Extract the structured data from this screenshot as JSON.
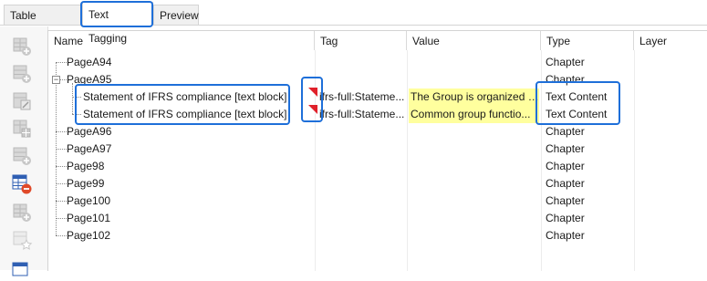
{
  "tabs": [
    {
      "label": "Table Tagging"
    },
    {
      "label": "Text Tagging"
    },
    {
      "label": "Preview"
    }
  ],
  "active_tab": "Text Tagging",
  "columns": {
    "name": "Name",
    "tag": "Tag",
    "value": "Value",
    "type": "Type",
    "layer": "Layer"
  },
  "rows": [
    {
      "name": "PageA94",
      "tag": "",
      "value": "",
      "type": "Chapter"
    },
    {
      "name": "PageA95",
      "tag": "",
      "value": "",
      "type": "Chapter"
    },
    {
      "name": "Statement of IFRS compliance [text block]",
      "tag": "ifrs-full:Stateme...",
      "value": "The Group is organized i...",
      "type": "Text Content"
    },
    {
      "name": "Statement of IFRS compliance [text block]",
      "tag": "ifrs-full:Stateme...",
      "value": "Common group functio...",
      "type": "Text Content"
    },
    {
      "name": "PageA96",
      "tag": "",
      "value": "",
      "type": "Chapter"
    },
    {
      "name": "PageA97",
      "tag": "",
      "value": "",
      "type": "Chapter"
    },
    {
      "name": "Page98",
      "tag": "",
      "value": "",
      "type": "Chapter"
    },
    {
      "name": "Page99",
      "tag": "",
      "value": "",
      "type": "Chapter"
    },
    {
      "name": "Page100",
      "tag": "",
      "value": "",
      "type": "Chapter"
    },
    {
      "name": "Page101",
      "tag": "",
      "value": "",
      "type": "Chapter"
    },
    {
      "name": "Page102",
      "tag": "",
      "value": "",
      "type": "Chapter"
    }
  ],
  "colors": {
    "highlight_border": "#1e6fd9",
    "value_highlight": "#ffff9e",
    "tag_marker": "#e0202a"
  },
  "toolbar_icons": [
    "add-table-icon",
    "add-row-icon",
    "edit-table-icon",
    "table-grid-icon",
    "add-table-icon-2",
    "remove-table-icon",
    "add-table-icon-3",
    "favorite-table-icon",
    "table-icon"
  ]
}
